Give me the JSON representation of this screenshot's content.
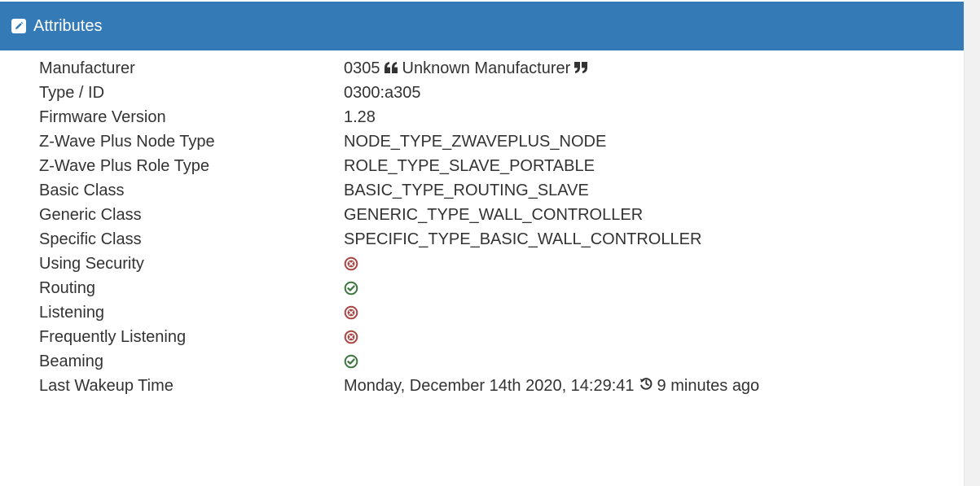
{
  "panel": {
    "title": "Attributes",
    "heading_icon": "edit-icon",
    "colors": {
      "heading_bg": "#337ab7",
      "heading_text": "#ffffff",
      "text": "#333333",
      "yes": "#3c763d",
      "no": "#a94442"
    }
  },
  "attributes": {
    "manufacturer": {
      "label": "Manufacturer",
      "code": "0305",
      "name": "Unknown Manufacturer",
      "open_quote_icon": "quote-left-icon",
      "close_quote_icon": "quote-right-icon"
    },
    "type_id": {
      "label": "Type / ID",
      "value": "0300:a305"
    },
    "firmware": {
      "label": "Firmware Version",
      "value": "1.28"
    },
    "zwave_plus_node_type": {
      "label": "Z-Wave Plus Node Type",
      "value": "NODE_TYPE_ZWAVEPLUS_NODE"
    },
    "zwave_plus_role_type": {
      "label": "Z-Wave Plus Role Type",
      "value": "ROLE_TYPE_SLAVE_PORTABLE"
    },
    "basic_class": {
      "label": "Basic Class",
      "value": "BASIC_TYPE_ROUTING_SLAVE"
    },
    "generic_class": {
      "label": "Generic Class",
      "value": "GENERIC_TYPE_WALL_CONTROLLER"
    },
    "specific_class": {
      "label": "Specific Class",
      "value": "SPECIFIC_TYPE_BASIC_WALL_CONTROLLER"
    },
    "using_security": {
      "label": "Using Security",
      "value": false,
      "icon": "times-circle-icon"
    },
    "routing": {
      "label": "Routing",
      "value": true,
      "icon": "check-circle-icon"
    },
    "listening": {
      "label": "Listening",
      "value": false,
      "icon": "times-circle-icon"
    },
    "frequently_listening": {
      "label": "Frequently Listening",
      "value": false,
      "icon": "times-circle-icon"
    },
    "beaming": {
      "label": "Beaming",
      "value": true,
      "icon": "check-circle-icon"
    },
    "last_wakeup": {
      "label": "Last Wakeup Time",
      "datetime": "Monday, December 14th 2020, 14:29:41",
      "relative": "9 minutes ago",
      "icon": "history-icon"
    }
  }
}
